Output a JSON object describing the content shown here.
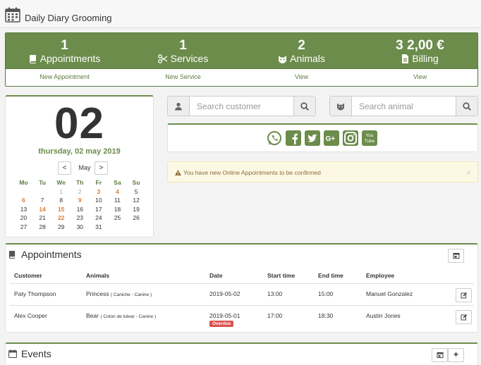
{
  "header": {
    "title": "Daily Diary Grooming",
    "icon": "calendar-icon"
  },
  "stats": [
    {
      "value": "1",
      "label": "Appointments",
      "link": "New Appointment",
      "icon": "book-icon"
    },
    {
      "value": "1",
      "label": "Services",
      "link": "New Service",
      "icon": "scissors-icon"
    },
    {
      "value": "2",
      "label": "Animals",
      "link": "View",
      "icon": "cat-icon"
    },
    {
      "value": "3 2,00 €",
      "label": "Billing",
      "link": "View",
      "icon": "file-invoice-icon"
    }
  ],
  "calendar": {
    "day": "02",
    "date_text": "thursday, 02 may 2019",
    "month": "May",
    "prev": "<",
    "next": ">",
    "weekdays": [
      "Mo",
      "Tu",
      "We",
      "Th",
      "Fr",
      "Sa",
      "Su"
    ],
    "weeks": [
      [
        "",
        "",
        "1",
        "2",
        "3",
        "4",
        "5"
      ],
      [
        "6",
        "7",
        "8",
        "9",
        "10",
        "11",
        "12"
      ],
      [
        "13",
        "14",
        "15",
        "16",
        "17",
        "18",
        "19"
      ],
      [
        "20",
        "21",
        "22",
        "23",
        "24",
        "25",
        "26"
      ],
      [
        "27",
        "28",
        "29",
        "30",
        "31",
        "",
        ""
      ]
    ],
    "highlighted_days": [
      "3",
      "4",
      "6",
      "9",
      "14",
      "15",
      "22"
    ],
    "muted_days": [
      "1",
      "2"
    ]
  },
  "search": {
    "customer_placeholder": "Search customer",
    "animal_placeholder": "Search animal"
  },
  "social": [
    "whatsapp-icon",
    "facebook-icon",
    "twitter-icon",
    "google-plus-icon",
    "instagram-icon",
    "youtube-icon"
  ],
  "alert": {
    "text": "You have new Online Appointments to be confirmed",
    "close": "×"
  },
  "appointments": {
    "title": "Appointments",
    "columns": [
      "Customer",
      "Animals",
      "Date",
      "Start time",
      "End time",
      "Employee"
    ],
    "rows": [
      {
        "customer": "Paty Thompson",
        "animal": "Princess",
        "breed": "( Caniche - Canine )",
        "date": "2019-05-02",
        "start": "13:00",
        "end": "15:00",
        "employee": "Manuel Gonzalez",
        "badge": ""
      },
      {
        "customer": "Alex Cooper",
        "animal": "Bear",
        "breed": "( Coton de tulear - Canine )",
        "date": "2019-05-01",
        "start": "17:00",
        "end": "18:30",
        "employee": "Austin Jones",
        "badge": "Overdue"
      }
    ]
  },
  "events": {
    "title": "Events",
    "add": "+"
  },
  "colors": {
    "accent": "#6c8c4b",
    "highlight": "#e07b39",
    "danger": "#d9534f"
  }
}
